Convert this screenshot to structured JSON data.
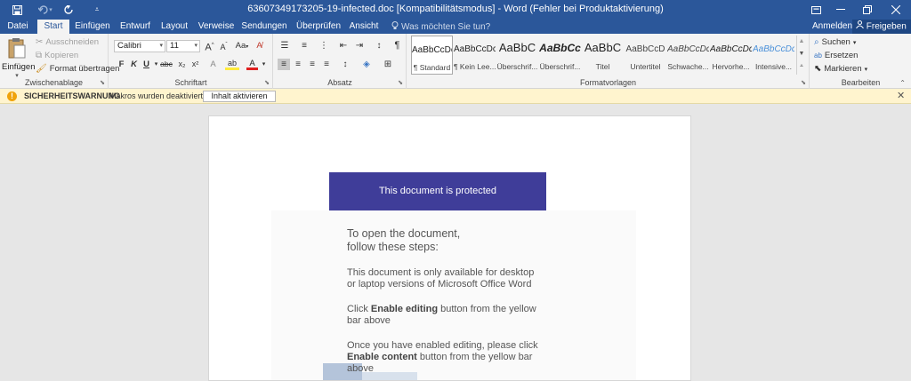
{
  "titlebar": {
    "title": "63607349173205-19-infected.doc [Kompatibilitätsmodus] - Word (Fehler bei Produktaktivierung)",
    "qa_save_icon": "save-icon",
    "qa_undo_icon": "undo-icon",
    "qa_redo_icon": "redo-icon",
    "qa_customize_icon": "customize-icon"
  },
  "tabs": [
    "Datei",
    "Start",
    "Einfügen",
    "Entwurf",
    "Layout",
    "Verweise",
    "Sendungen",
    "Überprüfen",
    "Ansicht"
  ],
  "tellme": {
    "placeholder": "Was möchten Sie tun?"
  },
  "account": {
    "signin": "Anmelden",
    "share": "Freigeben"
  },
  "clipboard": {
    "paste": "Einfügen",
    "cut": "Ausschneiden",
    "copy": "Kopieren",
    "format_painter": "Format übertragen",
    "label": "Zwischenablage"
  },
  "font": {
    "family": "Calibri",
    "size": "11",
    "grow": "A",
    "shrink": "A",
    "case": "Aa",
    "bold": "F",
    "italic": "K",
    "underline": "U",
    "strike": "abc",
    "sub": "x₂",
    "sup": "x²",
    "effects": "A",
    "highlight": "ab",
    "color": "A",
    "label": "Schriftart"
  },
  "paragraph": {
    "label": "Absatz",
    "pilcrow": "¶"
  },
  "styles": {
    "label": "Formatvorlagen",
    "items": [
      {
        "preview": "AaBbCcDc",
        "name": "¶ Standard"
      },
      {
        "preview": "AaBbCcDc",
        "name": "¶ Kein Lee..."
      },
      {
        "preview": "AaBbC",
        "name": "Überschrif..."
      },
      {
        "preview": "AaBbCc",
        "name": "Überschrif..."
      },
      {
        "preview": "AaBbC",
        "name": "Titel"
      },
      {
        "preview": "AaBbCcD",
        "name": "Untertitel"
      },
      {
        "preview": "AaBbCcDc",
        "name": "Schwache..."
      },
      {
        "preview": "AaBbCcDc",
        "name": "Hervorhe..."
      },
      {
        "preview": "AaBbCcDc",
        "name": "Intensive..."
      }
    ]
  },
  "editing": {
    "find": "Suchen",
    "replace": "Ersetzen",
    "select": "Markieren",
    "label": "Bearbeiten"
  },
  "security": {
    "label": "SICHERHEITSWARNUNG",
    "text": "Makros wurden deaktiviert.",
    "button": "Inhalt aktivieren"
  },
  "document": {
    "banner": "This document is protected",
    "open_line1": "To open the document,",
    "open_line2": "follow these steps:",
    "p1_line1": "This document is only available for desktop",
    "p1_line2": "or laptop versions of Microsoft Office Word",
    "p2_pre": "Click ",
    "p2_bold": "Enable editing",
    "p2_post": " button from the yellow",
    "p2_line2": "bar above",
    "p3_line1": "Once you have enabled editing, please click",
    "p3_bold": "Enable content",
    "p3_post": " button from the yellow bar",
    "p3_line3": "above"
  },
  "colors": {
    "titlebar": "#2b579a",
    "banner": "#3f3d99",
    "security_bar": "#fff4ce"
  }
}
